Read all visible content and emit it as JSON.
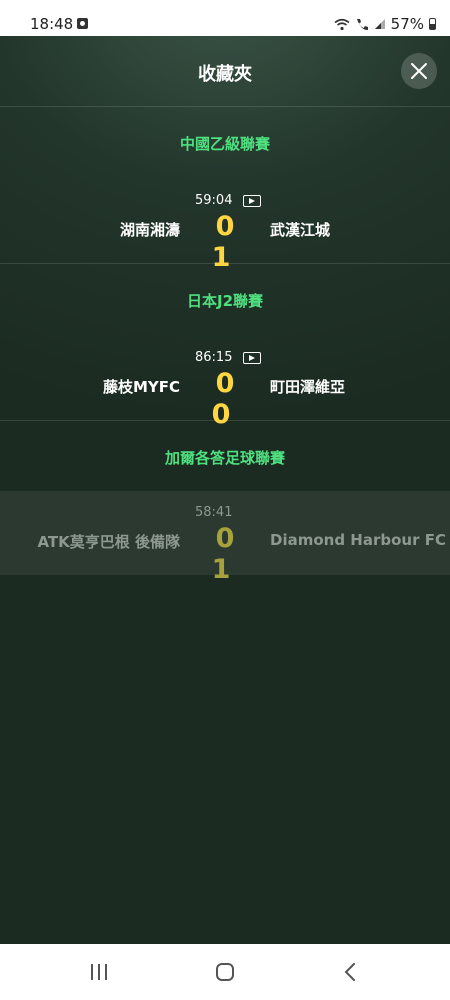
{
  "status_bar": {
    "time": "18:48",
    "signal_icons": "wifi-call-icon, signal-icon",
    "battery": "57%"
  },
  "header": {
    "title": "收藏夾",
    "close_icon": "close-icon"
  },
  "leagues": [
    {
      "name": "中國乙級聯賽",
      "match": {
        "clock": "59:04",
        "home": "湖南湘濤",
        "score": "0 1",
        "away": "武漢江城",
        "has_video": true
      }
    },
    {
      "name": "日本J2聯賽",
      "match": {
        "clock": "86:15",
        "home": "藤枝MYFC",
        "score": "0 0",
        "away": "町田澤維亞",
        "has_video": true
      }
    },
    {
      "name": "加爾各答足球聯賽",
      "match": {
        "clock": "58:41",
        "home": "ATK莫亨巴根 後備隊",
        "score": "0 1",
        "away": "Diamond Harbour FC",
        "has_video": false
      }
    }
  ],
  "colors": {
    "league_name": "#4ee07f",
    "score": "#ffd642",
    "panel_bg": "#1b2b22"
  }
}
